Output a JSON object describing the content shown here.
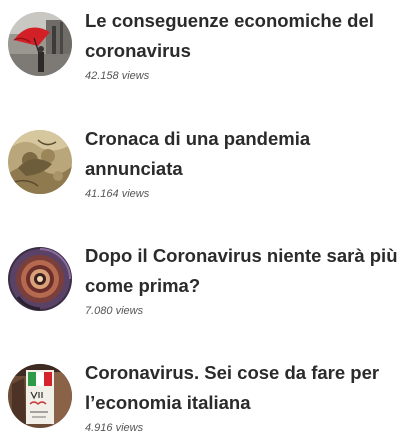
{
  "posts": [
    {
      "title": "Le conseguenze economiche del coronavirus",
      "views": "42.158 views",
      "thumbnail_icon": "red-umbrella-photo"
    },
    {
      "title": "Cronaca di una pandemia annunciata",
      "views": "41.164 views",
      "thumbnail_icon": "sepia-painting-photo"
    },
    {
      "title": "Dopo il Coronavirus niente sarà più come prima?",
      "views": "7.080 views",
      "thumbnail_icon": "spiral-staircase-photo"
    },
    {
      "title": "Coronavirus. Sei cose da fare per l’economia italiana",
      "views": "4.916 views",
      "thumbnail_icon": "italian-flag-sign-photo"
    }
  ],
  "colors": {
    "title": "#2b2b2b",
    "views": "#555555",
    "background": "#ffffff"
  }
}
